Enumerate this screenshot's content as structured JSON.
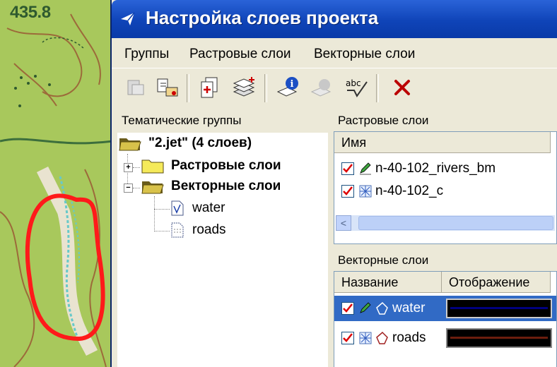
{
  "map": {
    "elevation_label": "435.8"
  },
  "window": {
    "title": "Настройка слоев проекта"
  },
  "menu": {
    "items": [
      "Группы",
      "Растровые слои",
      "Векторные слои"
    ]
  },
  "toolbar": {
    "buttons": [
      "remove-group-icon",
      "edit-group-icon",
      "copy-layers-icon",
      "add-layer-icon",
      "layer-info-icon",
      "disabled-layer-icon",
      "spellcheck-icon",
      "delete-icon"
    ]
  },
  "left_panel": {
    "header": "Тематические группы",
    "tree": {
      "root": "\"2.jet\" (4 слоев)",
      "groups": [
        {
          "label": "Растровые слои",
          "expanded": false,
          "children": []
        },
        {
          "label": "Векторные слои",
          "expanded": true,
          "children": [
            "water",
            "roads"
          ]
        }
      ]
    }
  },
  "raster_panel": {
    "header": "Растровые слои",
    "column": "Имя",
    "rows": [
      {
        "name": "n-40-102_rivers_bm",
        "checked": true
      },
      {
        "name": "n-40-102_c",
        "checked": true
      }
    ],
    "scroll_left": "<"
  },
  "vector_panel": {
    "header": "Векторные слои",
    "columns": [
      "Название",
      "Отображение"
    ],
    "rows": [
      {
        "name": "water",
        "checked": true,
        "selected": true,
        "style_color": "#000080"
      },
      {
        "name": "roads",
        "checked": true,
        "selected": false,
        "style_color": "#6b1e0e"
      }
    ]
  },
  "colors": {
    "titlebar": "#0f44b8",
    "selection": "#316ac5",
    "map_green": "#a8c85c",
    "highlight_ring": "#ff0000"
  }
}
